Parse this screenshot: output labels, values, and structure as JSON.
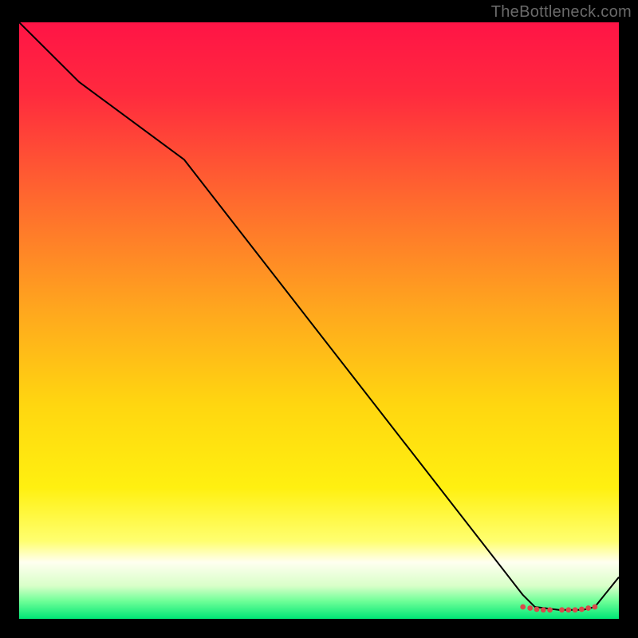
{
  "watermark": "TheBottleneck.com",
  "chart_data": {
    "type": "line",
    "title": "",
    "xlabel": "",
    "ylabel": "",
    "xlim": [
      0,
      100
    ],
    "ylim": [
      0,
      100
    ],
    "background_gradient": {
      "stops": [
        {
          "offset": 0.0,
          "color": "#ff1446"
        },
        {
          "offset": 0.12,
          "color": "#ff2a3e"
        },
        {
          "offset": 0.3,
          "color": "#ff6a2e"
        },
        {
          "offset": 0.48,
          "color": "#ffa61e"
        },
        {
          "offset": 0.64,
          "color": "#ffd610"
        },
        {
          "offset": 0.78,
          "color": "#fff010"
        },
        {
          "offset": 0.87,
          "color": "#ffff70"
        },
        {
          "offset": 0.905,
          "color": "#fffff0"
        },
        {
          "offset": 0.945,
          "color": "#d8ffc8"
        },
        {
          "offset": 0.97,
          "color": "#70ff98"
        },
        {
          "offset": 1.0,
          "color": "#00e676"
        }
      ]
    },
    "series": [
      {
        "name": "bottleneck-curve",
        "color": "#000000",
        "stroke_width": 2,
        "x": [
          0,
          10,
          27.5,
          84,
          86,
          90,
          94,
          96,
          100
        ],
        "y": [
          100,
          90,
          77,
          4,
          2,
          1.5,
          1.5,
          2,
          7
        ]
      }
    ],
    "markers": {
      "name": "flat-zone-dots",
      "color": "#d94a4a",
      "radius": 3.4,
      "points": [
        {
          "x": 84.0,
          "y": 2.0
        },
        {
          "x": 85.2,
          "y": 1.8
        },
        {
          "x": 86.3,
          "y": 1.6
        },
        {
          "x": 87.4,
          "y": 1.5
        },
        {
          "x": 88.5,
          "y": 1.5
        },
        {
          "x": 90.5,
          "y": 1.5
        },
        {
          "x": 91.6,
          "y": 1.5
        },
        {
          "x": 92.7,
          "y": 1.5
        },
        {
          "x": 93.8,
          "y": 1.6
        },
        {
          "x": 94.9,
          "y": 1.8
        },
        {
          "x": 96.0,
          "y": 2.0
        }
      ]
    }
  }
}
